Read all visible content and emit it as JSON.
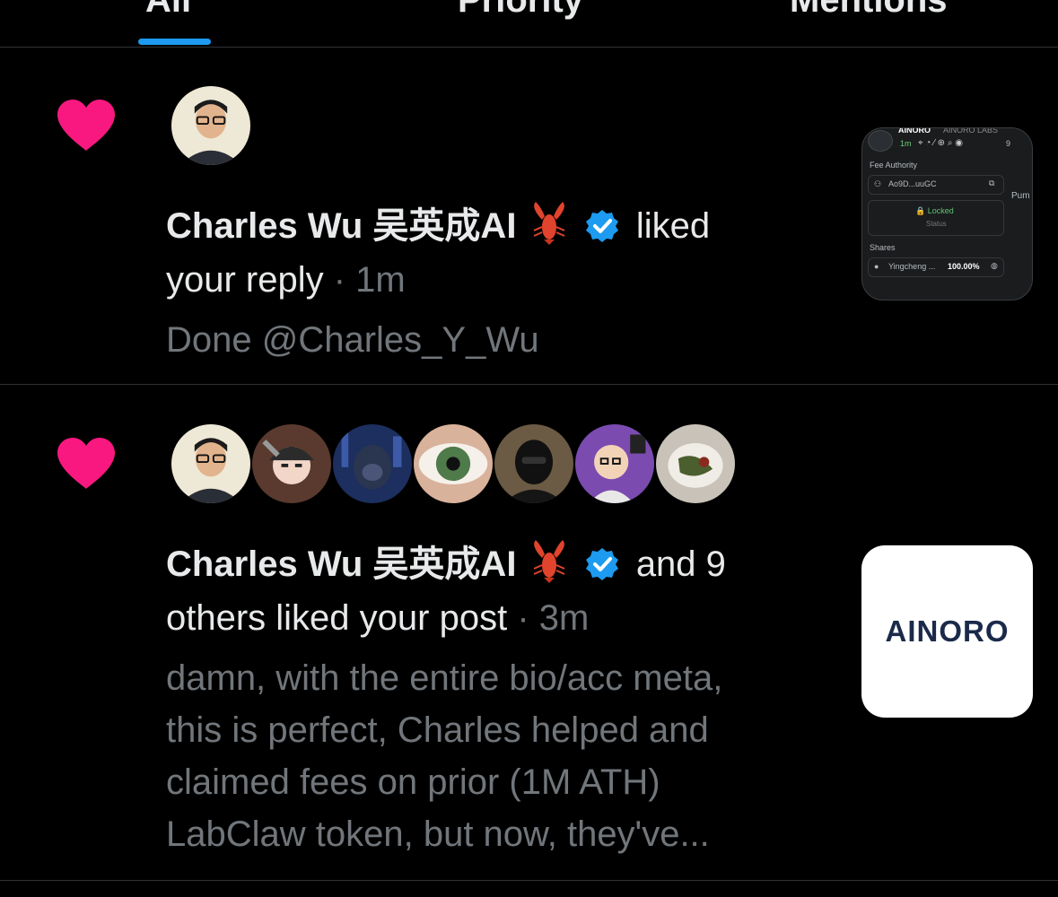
{
  "tabs": [
    {
      "label": "All"
    },
    {
      "label": "Priority"
    },
    {
      "label": "Mentions"
    }
  ],
  "colors": {
    "heart": "#f91880",
    "verified": "#1d9bf0",
    "muted": "#71767b",
    "text": "#e7e9ea"
  },
  "notifications": [
    {
      "user": "Charles Wu 吴英成AI",
      "action": "liked",
      "action2": "your reply",
      "time": "1m",
      "text": "Done @Charles_Y_Wu",
      "thumb": {
        "brand": "AINORO",
        "brand_full": "AINORO LABS",
        "age": "1m",
        "section1": "Fee Authority",
        "address": "Ao9D...uuGC",
        "status": "Locked",
        "status_label": "Status",
        "section2": "Shares",
        "holder": "Yingcheng ...",
        "share": "100.00%",
        "side": "Pum",
        "views": "9"
      }
    },
    {
      "user": "Charles Wu 吴英成AI",
      "action": "and 9",
      "action2": "others liked your post",
      "time": "3m",
      "text_lines": [
        "damn, with the entire bio/acc meta,",
        "this is perfect, Charles helped and",
        "claimed fees on prior (1M ATH)",
        "LabClaw token, but now, they've..."
      ],
      "thumb": {
        "brand": "AINORO"
      }
    }
  ]
}
